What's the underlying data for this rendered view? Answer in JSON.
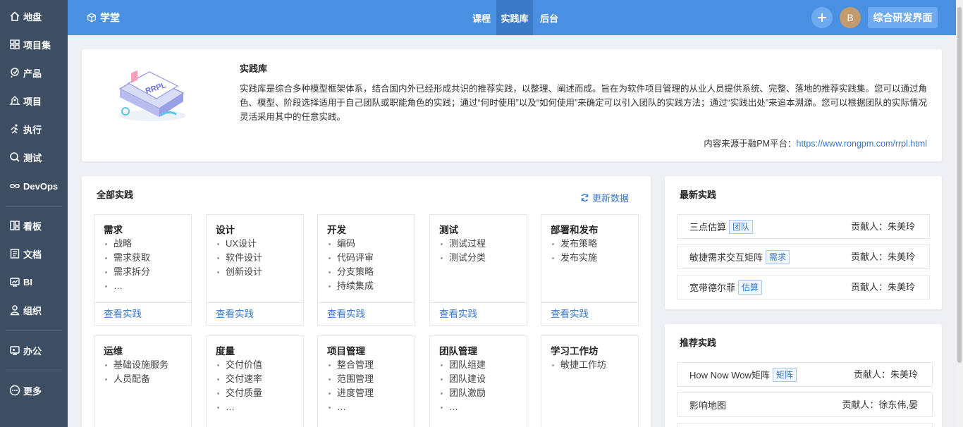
{
  "sidebar": {
    "items": [
      {
        "label": "地盘",
        "icon": "home-icon"
      },
      {
        "label": "项目集",
        "icon": "grid-icon"
      },
      {
        "label": "产品",
        "icon": "product-icon"
      },
      {
        "label": "项目",
        "icon": "project-icon"
      },
      {
        "label": "执行",
        "icon": "run-icon"
      },
      {
        "label": "测试",
        "icon": "test-icon"
      },
      {
        "label": "DevOps",
        "icon": "infinity-icon"
      },
      {
        "label": "看板",
        "icon": "kanban-icon"
      },
      {
        "label": "文档",
        "icon": "doc-icon"
      },
      {
        "label": "BI",
        "icon": "bi-icon"
      },
      {
        "label": "组织",
        "icon": "org-icon"
      },
      {
        "label": "办公",
        "icon": "office-icon"
      },
      {
        "label": "更多",
        "icon": "more-icon"
      }
    ]
  },
  "topbar": {
    "brand": "学堂",
    "nav": [
      "课程",
      "实践库",
      "后台"
    ],
    "active_nav": "实践库",
    "avatar_letter": "B",
    "workspace_button": "综合研发界面"
  },
  "intro": {
    "title": "实践库",
    "description": "实践库是综合多种模型框架体系，结合国内外已经形成共识的推荐实践，以整理、阐述而成。旨在为软件项目管理的从业人员提供系统、完整、落地的推荐实践集。您可以通过角色、模型、阶段选择适用于自己团队或职能角色的实践；通过“何时使用”以及“如何使用”来确定可以引入团队的实践方法；通过“实践出处”来追本溯源。您可以根据团队的实际情况灵活采用其中的任意实践。",
    "source_label": "内容来源于融PM平台：",
    "source_link": "https://www.rongpm.com/rrpl.html",
    "logo_text": "RRPL"
  },
  "all_practices": {
    "title": "全部实践",
    "refresh_label": "更新数据",
    "view_label": "查看实践",
    "categories": [
      {
        "title": "需求",
        "items": [
          "战略",
          "需求获取",
          "需求拆分",
          "…"
        ]
      },
      {
        "title": "设计",
        "items": [
          "UX设计",
          "软件设计",
          "创新设计"
        ]
      },
      {
        "title": "开发",
        "items": [
          "编码",
          "代码评审",
          "分支策略",
          "持续集成"
        ]
      },
      {
        "title": "测试",
        "items": [
          "测试过程",
          "测试分类"
        ]
      },
      {
        "title": "部署和发布",
        "items": [
          "发布策略",
          "发布实施"
        ]
      },
      {
        "title": "运维",
        "items": [
          "基础设施服务",
          "人员配备"
        ]
      },
      {
        "title": "度量",
        "items": [
          "交付价值",
          "交付速率",
          "交付质量",
          "…"
        ]
      },
      {
        "title": "项目管理",
        "items": [
          "整合管理",
          "范围管理",
          "进度管理",
          "…"
        ]
      },
      {
        "title": "团队管理",
        "items": [
          "团队组建",
          "团队建设",
          "团队激励",
          "…"
        ]
      },
      {
        "title": "学习工作坊",
        "items": [
          "敏捷工作坊"
        ]
      }
    ]
  },
  "latest": {
    "title": "最新实践",
    "rows": [
      {
        "name": "三点估算",
        "tag": "团队",
        "contributor": "贡献人：朱美玲"
      },
      {
        "name": "敏捷需求交互矩阵",
        "tag": "需求",
        "contributor": "贡献人：朱美玲"
      },
      {
        "name": "宽带德尔菲",
        "tag": "估算",
        "contributor": "贡献人：朱美玲"
      }
    ]
  },
  "recommended": {
    "title": "推荐实践",
    "rows": [
      {
        "name": "How Now Wow矩阵",
        "tag": "矩阵",
        "contributor": "贡献人：朱美玲"
      },
      {
        "name": "影响地图",
        "tag": "",
        "contributor": "贡献人：徐东伟,晏"
      }
    ]
  },
  "colors": {
    "primary": "#4a90e2",
    "sidebar": "#3d4e63",
    "link": "#3a7ac7"
  }
}
